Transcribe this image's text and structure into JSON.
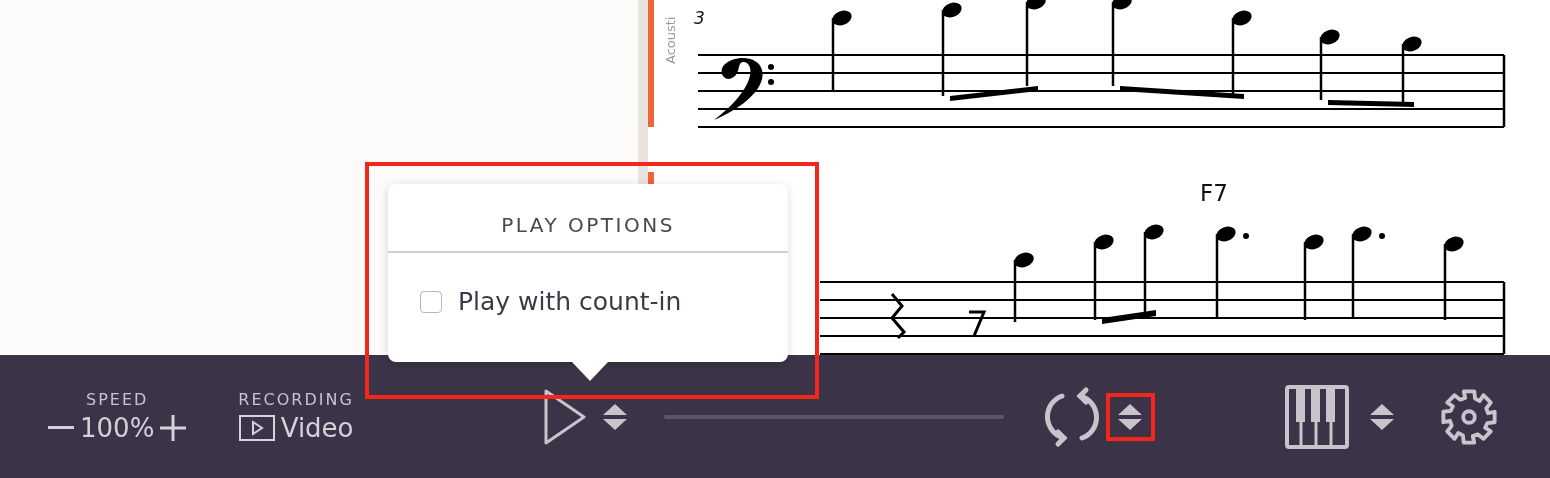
{
  "side_tab": {
    "label": "Acousti"
  },
  "score": {
    "measure_number": "3",
    "chord": "F7"
  },
  "popover": {
    "title": "PLAY OPTIONS",
    "highlighted": true,
    "options": [
      {
        "label": "Play with count-in",
        "checked": false
      }
    ]
  },
  "toolbar": {
    "speed": {
      "label": "SPEED",
      "value": "100%"
    },
    "recording": {
      "label": "RECORDING",
      "value": "Video"
    },
    "loop_options": {
      "highlighted": true
    }
  }
}
